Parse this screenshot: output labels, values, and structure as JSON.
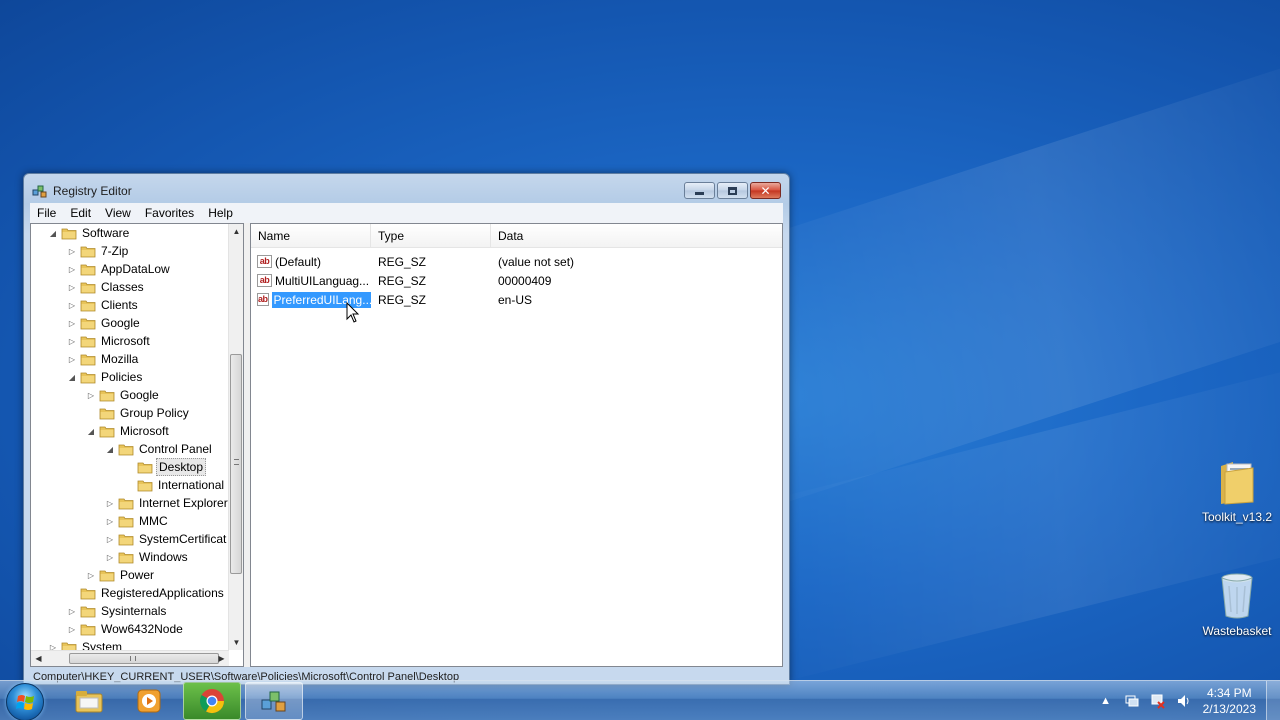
{
  "window": {
    "title": "Registry Editor"
  },
  "menu": [
    "File",
    "Edit",
    "View",
    "Favorites",
    "Help"
  ],
  "tree": [
    {
      "label": "Software",
      "indent": 0,
      "state": "open"
    },
    {
      "label": "7-Zip",
      "indent": 1,
      "state": "closed"
    },
    {
      "label": "AppDataLow",
      "indent": 1,
      "state": "closed"
    },
    {
      "label": "Classes",
      "indent": 1,
      "state": "closed"
    },
    {
      "label": "Clients",
      "indent": 1,
      "state": "closed"
    },
    {
      "label": "Google",
      "indent": 1,
      "state": "closed"
    },
    {
      "label": "Microsoft",
      "indent": 1,
      "state": "closed"
    },
    {
      "label": "Mozilla",
      "indent": 1,
      "state": "closed"
    },
    {
      "label": "Policies",
      "indent": 1,
      "state": "open"
    },
    {
      "label": "Google",
      "indent": 2,
      "state": "closed"
    },
    {
      "label": "Group Policy",
      "indent": 2,
      "state": "none"
    },
    {
      "label": "Microsoft",
      "indent": 2,
      "state": "open"
    },
    {
      "label": "Control Panel",
      "indent": 3,
      "state": "open"
    },
    {
      "label": "Desktop",
      "indent": 4,
      "state": "none",
      "selected": true
    },
    {
      "label": "International",
      "indent": 4,
      "state": "none"
    },
    {
      "label": "Internet Explorer",
      "indent": 3,
      "state": "closed"
    },
    {
      "label": "MMC",
      "indent": 3,
      "state": "closed"
    },
    {
      "label": "SystemCertificat",
      "indent": 3,
      "state": "closed"
    },
    {
      "label": "Windows",
      "indent": 3,
      "state": "closed"
    },
    {
      "label": "Power",
      "indent": 2,
      "state": "closed"
    },
    {
      "label": "RegisteredApplications",
      "indent": 1,
      "state": "none"
    },
    {
      "label": "Sysinternals",
      "indent": 1,
      "state": "closed"
    },
    {
      "label": "Wow6432Node",
      "indent": 1,
      "state": "closed"
    },
    {
      "label": "System",
      "indent": 0,
      "state": "closed"
    }
  ],
  "list": {
    "columns": [
      "Name",
      "Type",
      "Data"
    ],
    "rows": [
      {
        "name": "(Default)",
        "type": "REG_SZ",
        "data": "(value not set)"
      },
      {
        "name": "MultiUILanguag...",
        "type": "REG_SZ",
        "data": "00000409"
      },
      {
        "name": "PreferredUILang...",
        "type": "REG_SZ",
        "data": "en-US",
        "selected": true
      }
    ],
    "icon": "ab"
  },
  "status": "Computer\\HKEY_CURRENT_USER\\Software\\Policies\\Microsoft\\Control Panel\\Desktop",
  "desktop_icons": [
    {
      "label": "Toolkit_v13.2",
      "icon": "folder-icon"
    },
    {
      "label": "Wastebasket",
      "icon": "recycle-bin-icon"
    }
  ],
  "taskbar": {
    "time": "4:34 PM",
    "date": "2/13/2023"
  },
  "colors": {
    "selection": "#3399ff",
    "folder": "#e8c45a"
  }
}
